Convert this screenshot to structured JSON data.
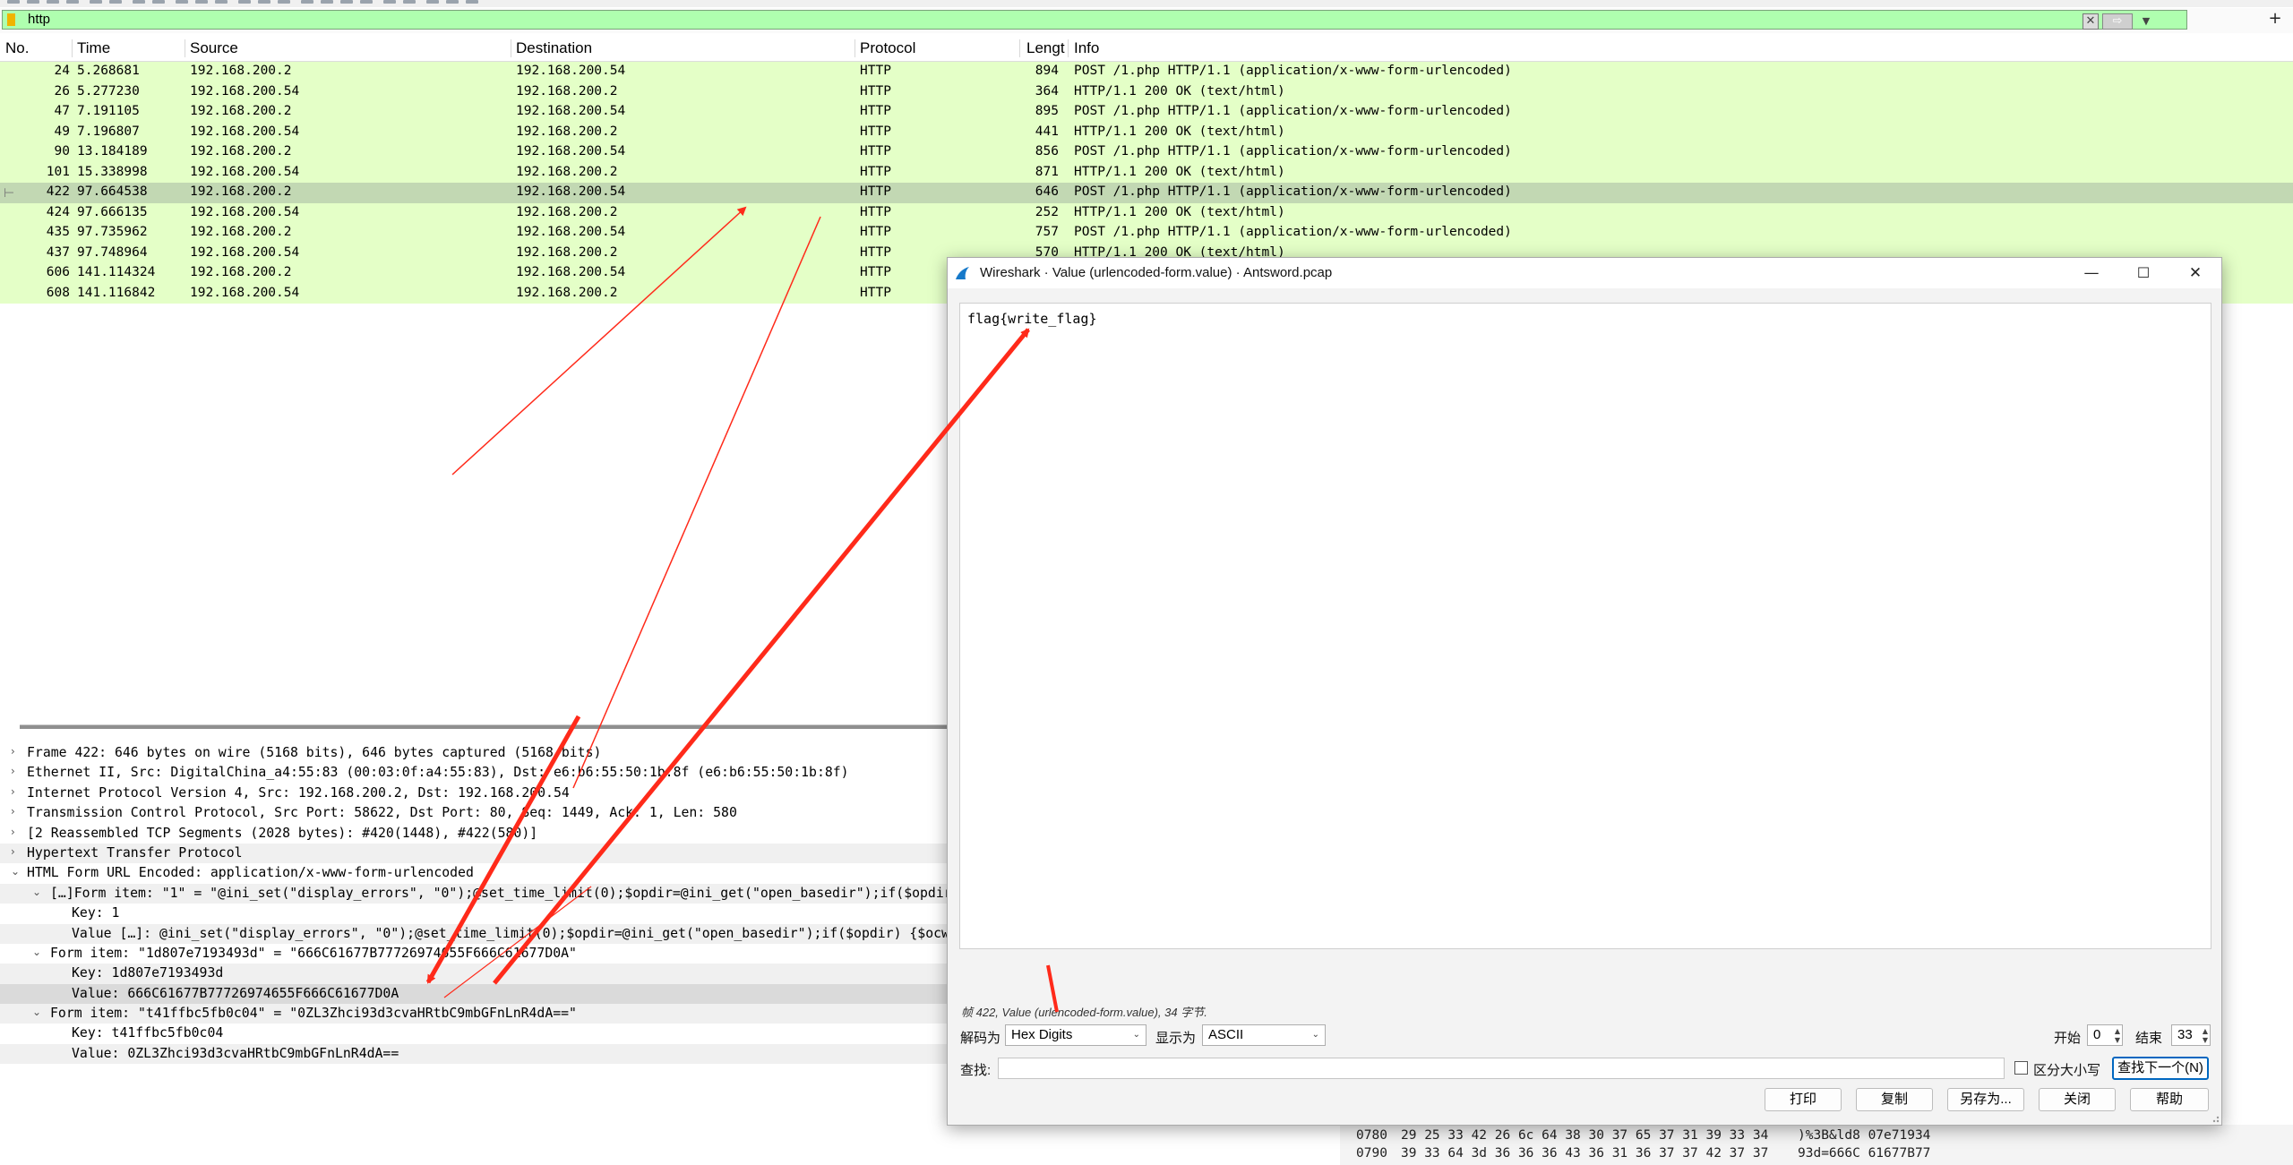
{
  "filter": {
    "value": "http",
    "clear_glyph": "✕",
    "apply_glyph": "⇨",
    "dropdown_glyph": "▼",
    "add_glyph": "+"
  },
  "packet_list": {
    "columns": [
      "No.",
      "Time",
      "Source",
      "Destination",
      "Protocol",
      "Lengt",
      "Info"
    ],
    "rows": [
      {
        "no": "24",
        "time": "5.268681",
        "src": "192.168.200.2",
        "dst": "192.168.200.54",
        "proto": "HTTP",
        "len": "894",
        "info": "POST /1.php HTTP/1.1  (application/x-www-form-urlencoded)"
      },
      {
        "no": "26",
        "time": "5.277230",
        "src": "192.168.200.54",
        "dst": "192.168.200.2",
        "proto": "HTTP",
        "len": "364",
        "info": "HTTP/1.1 200 OK  (text/html)"
      },
      {
        "no": "47",
        "time": "7.191105",
        "src": "192.168.200.2",
        "dst": "192.168.200.54",
        "proto": "HTTP",
        "len": "895",
        "info": "POST /1.php HTTP/1.1  (application/x-www-form-urlencoded)"
      },
      {
        "no": "49",
        "time": "7.196807",
        "src": "192.168.200.54",
        "dst": "192.168.200.2",
        "proto": "HTTP",
        "len": "441",
        "info": "HTTP/1.1 200 OK  (text/html)"
      },
      {
        "no": "90",
        "time": "13.184189",
        "src": "192.168.200.2",
        "dst": "192.168.200.54",
        "proto": "HTTP",
        "len": "856",
        "info": "POST /1.php HTTP/1.1  (application/x-www-form-urlencoded)"
      },
      {
        "no": "101",
        "time": "15.338998",
        "src": "192.168.200.54",
        "dst": "192.168.200.2",
        "proto": "HTTP",
        "len": "871",
        "info": "HTTP/1.1 200 OK  (text/html)"
      },
      {
        "no": "422",
        "time": "97.664538",
        "src": "192.168.200.2",
        "dst": "192.168.200.54",
        "proto": "HTTP",
        "len": "646",
        "info": "POST /1.php HTTP/1.1  (application/x-www-form-urlencoded)",
        "selected": true
      },
      {
        "no": "424",
        "time": "97.666135",
        "src": "192.168.200.54",
        "dst": "192.168.200.2",
        "proto": "HTTP",
        "len": "252",
        "info": "HTTP/1.1 200 OK  (text/html)"
      },
      {
        "no": "435",
        "time": "97.735962",
        "src": "192.168.200.2",
        "dst": "192.168.200.54",
        "proto": "HTTP",
        "len": "757",
        "info": "POST /1.php HTTP/1.1  (application/x-www-form-urlencoded)"
      },
      {
        "no": "437",
        "time": "97.748964",
        "src": "192.168.200.54",
        "dst": "192.168.200.2",
        "proto": "HTTP",
        "len": "570",
        "info": "HTTP/1.1 200 OK  (text/html)"
      },
      {
        "no": "606",
        "time": "141.114324",
        "src": "192.168.200.2",
        "dst": "192.168.200.54",
        "proto": "HTTP",
        "len": "",
        "info": ""
      },
      {
        "no": "608",
        "time": "141.116842",
        "src": "192.168.200.54",
        "dst": "192.168.200.2",
        "proto": "HTTP",
        "len": "",
        "info": ""
      }
    ]
  },
  "details": [
    {
      "indent": 0,
      "arrow": "›",
      "text": "Frame 422: 646 bytes on wire (5168 bits), 646 bytes captured (5168 bits)"
    },
    {
      "indent": 0,
      "arrow": "›",
      "text": "Ethernet II, Src: DigitalChina_a4:55:83 (00:03:0f:a4:55:83), Dst: e6:b6:55:50:1b:8f (e6:b6:55:50:1b:8f)"
    },
    {
      "indent": 0,
      "arrow": "›",
      "text": "Internet Protocol Version 4, Src: 192.168.200.2, Dst: 192.168.200.54"
    },
    {
      "indent": 0,
      "arrow": "›",
      "text": "Transmission Control Protocol, Src Port: 58622, Dst Port: 80, Seq: 1449, Ack: 1, Len: 580"
    },
    {
      "indent": 0,
      "arrow": "›",
      "text": "[2 Reassembled TCP Segments (2028 bytes): #420(1448), #422(580)]"
    },
    {
      "indent": 0,
      "arrow": "›",
      "text": "Hypertext Transfer Protocol"
    },
    {
      "indent": 0,
      "arrow": "⌄",
      "text": "HTML Form URL Encoded: application/x-www-form-urlencoded"
    },
    {
      "indent": 1,
      "arrow": "⌄",
      "text": "[…]Form item: \"1\" = \"@ini_set(\"display_errors\", \"0\");@set_time_limit(0);$opdir=@ini_get(\"open_basedir\");if($opdir"
    },
    {
      "indent": 2,
      "arrow": "",
      "text": "Key: 1"
    },
    {
      "indent": 2,
      "arrow": "",
      "text": "Value […]: @ini_set(\"display_errors\", \"0\");@set_time_limit(0);$opdir=@ini_get(\"open_basedir\");if($opdir) {$ocw"
    },
    {
      "indent": 1,
      "arrow": "⌄",
      "text": "Form item: \"1d807e7193493d\" = \"666C61677B77726974655F666C61677D0A\""
    },
    {
      "indent": 2,
      "arrow": "",
      "text": "Key: 1d807e7193493d"
    },
    {
      "indent": 2,
      "arrow": "",
      "text": "Value: 666C61677B77726974655F666C61677D0A",
      "selected": true
    },
    {
      "indent": 1,
      "arrow": "⌄",
      "text": "Form item: \"t41ffbc5fb0c04\" = \"0ZL3Zhci93d3cvaHRtbC9mbGFnLnR4dA==\""
    },
    {
      "indent": 2,
      "arrow": "",
      "text": "Key: t41ffbc5fb0c04"
    },
    {
      "indent": 2,
      "arrow": "",
      "text": "Value: 0ZL3Zhci93d3cvaHRtbC9mbGFnLnR4dA=="
    }
  ],
  "hex": [
    {
      "offset": "0780",
      "bytes": "29 25 33 42 26 6c 64 38   30 37 65 37 31 39 33 34",
      "ascii": ")%3B&ld8 07e71934"
    },
    {
      "offset": "0790",
      "bytes": "39 33 64 3d 36 36 36 43   36 31 36 37 37 42 37 37",
      "ascii": "93d=666C 61677B77"
    }
  ],
  "dialog": {
    "title": "Wireshark · Value (urlencoded-form.value) · Antsword.pcap",
    "min_glyph": "—",
    "max_glyph": "☐",
    "close_glyph": "✕",
    "content": "flag{write_flag}",
    "info": "帧 422, Value (urlencoded-form.value), 34 字节.",
    "decode_label": "解码为",
    "decode_value": "Hex Digits",
    "show_label": "显示为",
    "show_value": "ASCII",
    "start_label": "开始",
    "start_value": "0",
    "end_label": "结束",
    "end_value": "33",
    "find_label": "查找:",
    "find_value": "",
    "case_label": "区分大小写",
    "find_next": "查找下一个(N)",
    "buttons": {
      "print": "打印",
      "copy": "复制",
      "save_as": "另存为...",
      "close": "关闭",
      "help": "帮助"
    }
  },
  "colors": {
    "filter_ok": "#afffaf",
    "row_http": "#e4ffc7",
    "row_selected": "#c2d8b3",
    "annotation_arrow": "#ff2a1a",
    "dialog_default_btn": "#0067c0"
  }
}
